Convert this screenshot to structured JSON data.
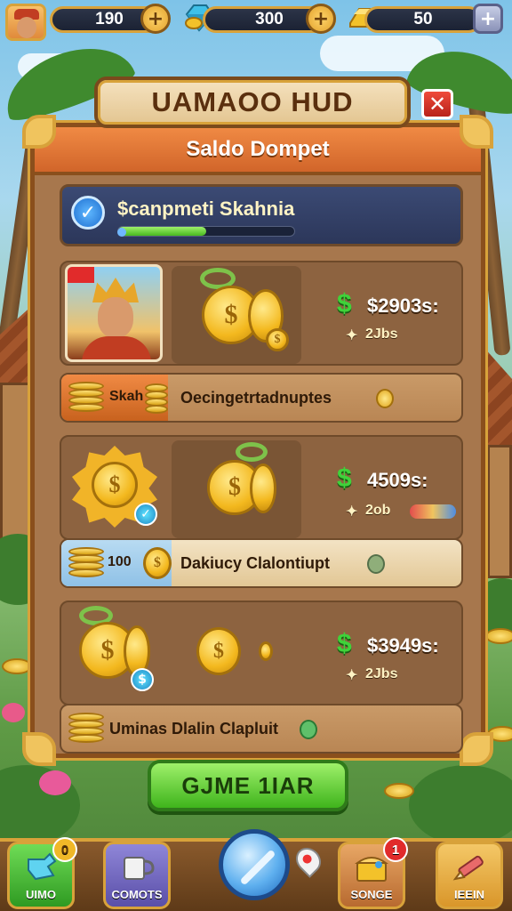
{
  "hud": {
    "coins": "190",
    "gems": "300",
    "gold": "50",
    "plus": "+"
  },
  "title": "UAMAOO HUD",
  "close": "✕",
  "panel": {
    "header": "Saldo Dompet",
    "wallet": {
      "title": "$canpmeti Skahnia",
      "progress": 0.5
    },
    "rows": [
      {
        "price": "$2903s:",
        "sub": "2Jbs"
      },
      {
        "price": "4509s:",
        "sub": "2ob"
      },
      {
        "price": "$3949s:",
        "sub": "2Jbs"
      }
    ],
    "strips": [
      {
        "left_label": "Skah",
        "label": "Oecingetrtadnuptes"
      },
      {
        "left_label": "100",
        "label": "Dakiucy Clalontiupt"
      },
      {
        "label": "Uminas Dlalin Clapluit"
      }
    ]
  },
  "play_button": "GJME 1IAR",
  "nav": {
    "items": [
      {
        "label": "UIMO",
        "badge": "0"
      },
      {
        "label": "COMOTS"
      },
      {
        "label": "SONGE",
        "badge": "1"
      },
      {
        "label": "IEEIN"
      }
    ]
  },
  "colors": {
    "accent_gold": "#d8a23a",
    "panel_brown": "#a7774d",
    "header_orange": "#f08a44",
    "price_green": "#3fd23a",
    "play_green": "#3fb41c"
  },
  "icons": [
    "avatar",
    "gem-icon",
    "gold-bar-icon",
    "check-icon",
    "coin-icon",
    "coin-stack-icon",
    "gear-coin-icon",
    "close-icon",
    "cup-icon",
    "chest-icon",
    "pencil-icon",
    "map-pin-icon"
  ]
}
